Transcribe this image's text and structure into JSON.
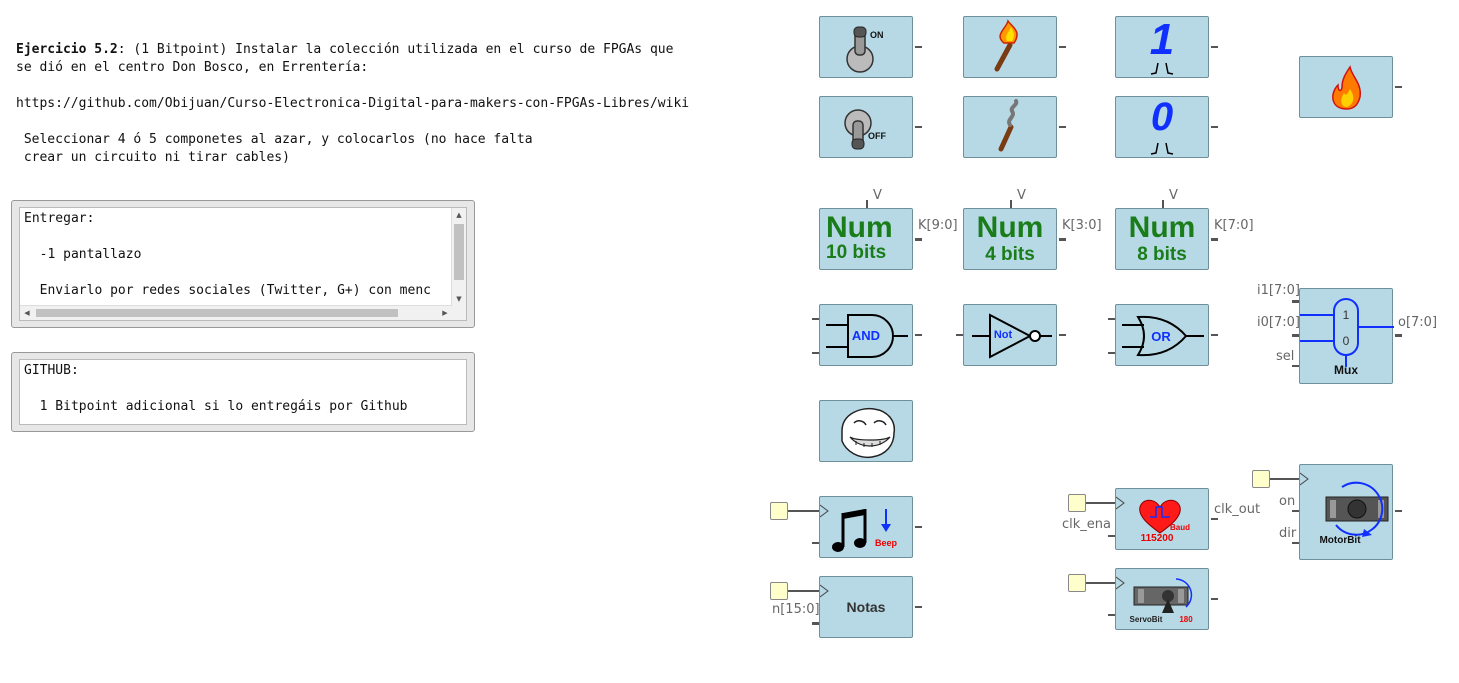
{
  "intro": {
    "exercise_title": "Ejercicio 5.2",
    "line1_rest": ": (1 Bitpoint) Instalar la colección utilizada en el curso de FPGAs que",
    "line2": "se dió en el centro Don Bosco, en Errentería:",
    "url": "https://github.com/Obijuan/Curso-Electronica-Digital-para-makers-con-FPGAs-Libres/wiki",
    "line4": " Seleccionar 4 ó 5 componetes al azar, y colocarlos (no hace falta",
    "line5": " crear un circuito ni tirar cables)"
  },
  "note_entregar": {
    "line1": "Entregar:",
    "line2": "  -1 pantallazo",
    "line3": "  Enviarlo por redes sociales (Twitter, G+) con menc"
  },
  "note_github": {
    "line1": "GITHUB:",
    "line2": "  1 Bitpoint adicional si lo entregáis por Github"
  },
  "blocks": {
    "switch_on_label": "ON",
    "switch_off_label": "OFF",
    "one_glyph": "1",
    "zero_glyph": "0",
    "num10": {
      "big": "Num",
      "small": "10 bits",
      "out": "K[9:0]",
      "top": "V"
    },
    "num4": {
      "big": "Num",
      "small": "4 bits",
      "out": "K[3:0]",
      "top": "V"
    },
    "num8": {
      "big": "Num",
      "small": "8 bits",
      "out": "K[7:0]",
      "top": "V"
    },
    "and_label": "AND",
    "not_label": "Not",
    "or_label": "OR",
    "mux": {
      "in1": "i1[7:0]",
      "in0": "i0[7:0]",
      "sel": "sel",
      "out": "o[7:0]",
      "one": "1",
      "zero": "0",
      "name": "Mux"
    },
    "beep_label": "Beep",
    "notas": {
      "label": "Notas",
      "in": "n[15:0]"
    },
    "heart": {
      "in": "clk_ena",
      "out": "clk_out",
      "baud": "Baud",
      "rate": "115200"
    },
    "servo": {
      "name": "ServoBit",
      "deg": "180"
    },
    "motor": {
      "on": "on",
      "dir": "dir",
      "name": "MotorBit"
    }
  }
}
